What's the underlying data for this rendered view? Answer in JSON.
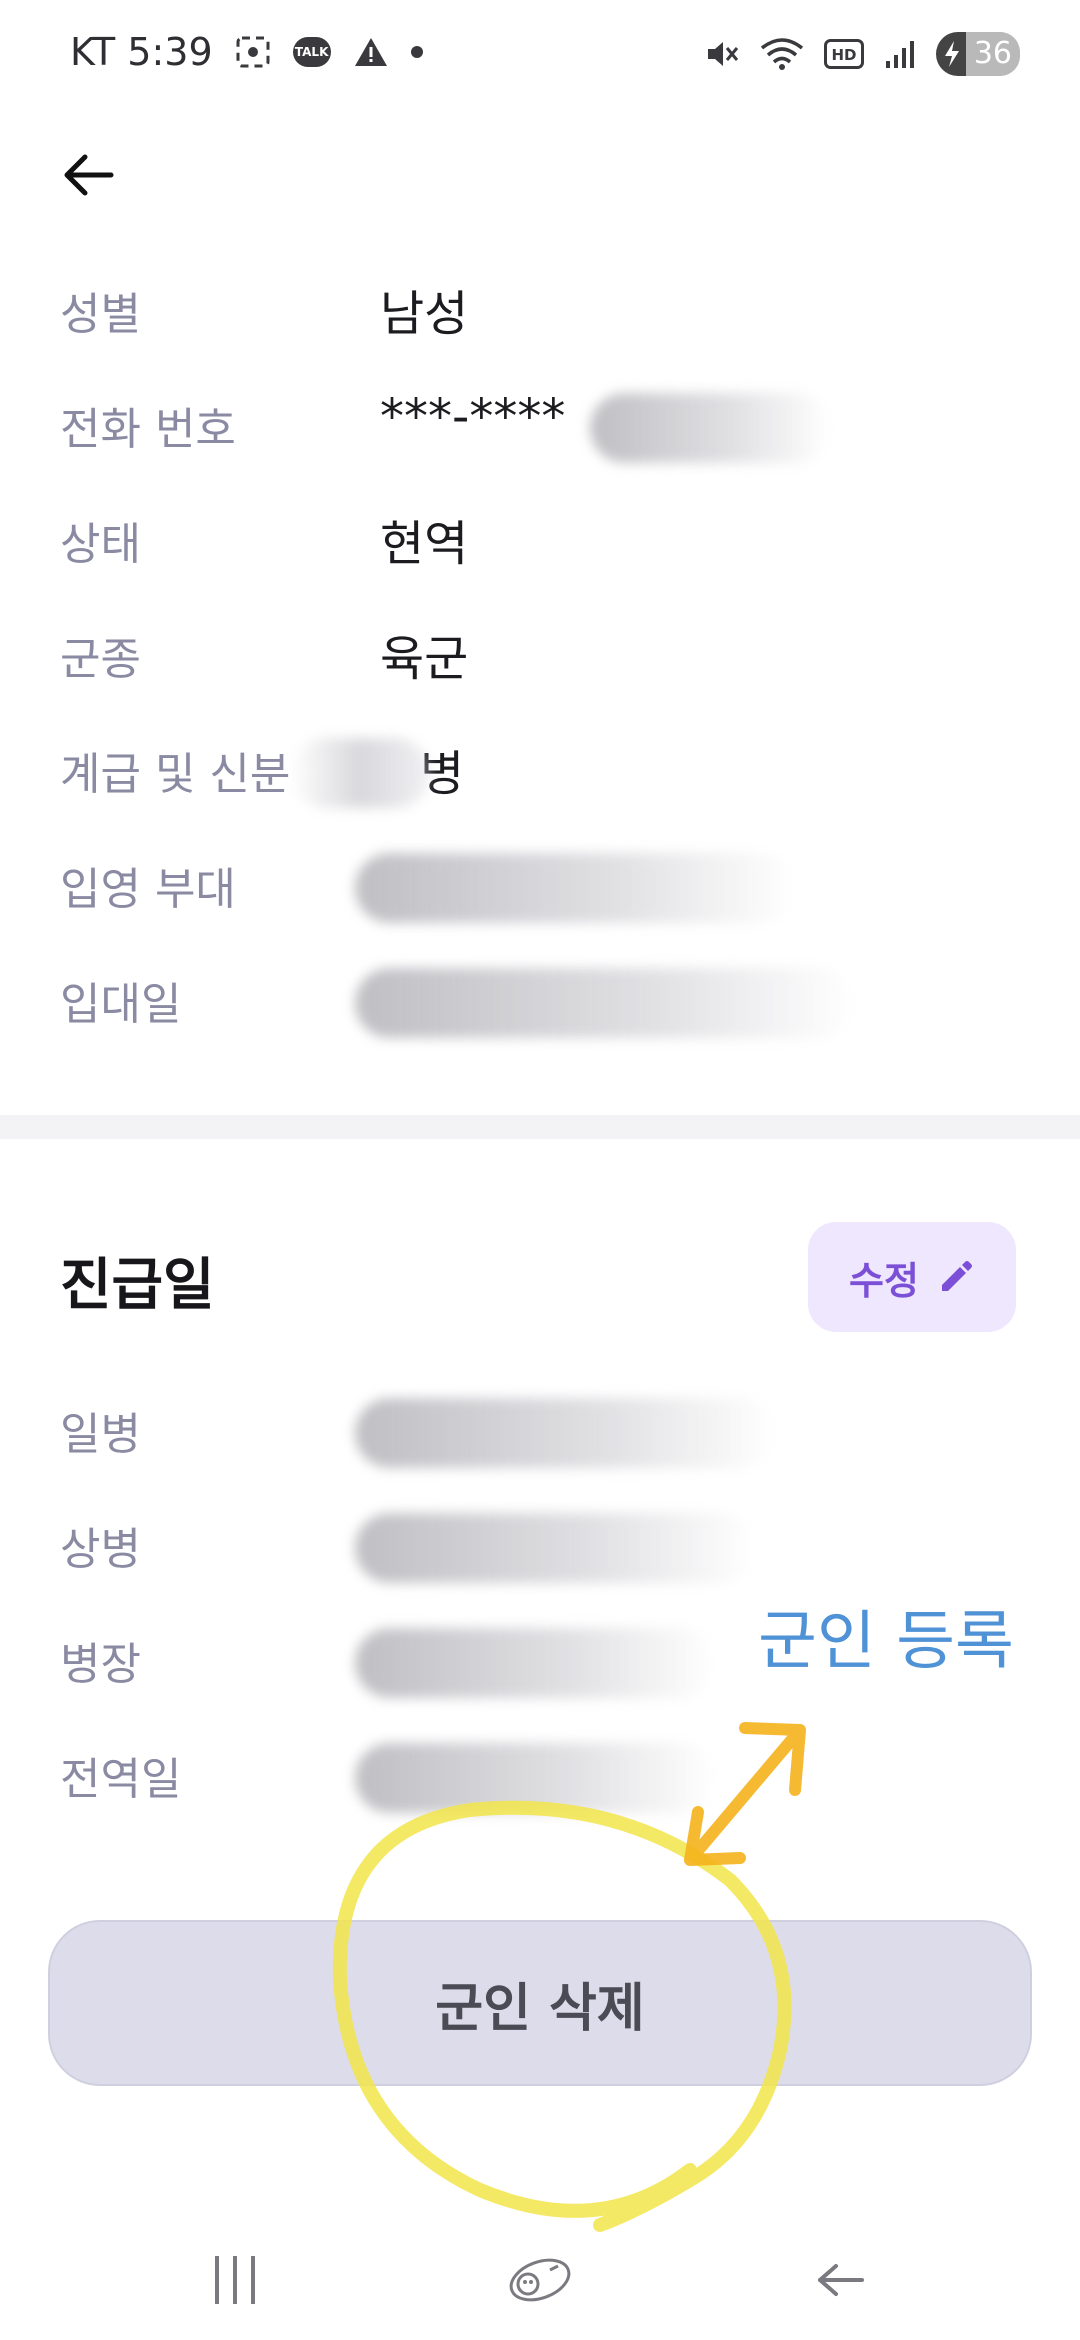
{
  "status_bar": {
    "carrier": "KT",
    "time": "5:39",
    "talk_badge": "TALK",
    "hd_badge": "HD",
    "battery_level": "36",
    "icons": [
      "screenshot-icon",
      "kakaotalk-icon",
      "warning-icon",
      "dot-icon",
      "mute-icon",
      "wifi-icon",
      "hd-icon",
      "signal-icon",
      "battery-charging-icon"
    ]
  },
  "header": {
    "back_icon": "arrow-left-icon"
  },
  "profile": {
    "rows": [
      {
        "label": "성별",
        "value": "남성"
      },
      {
        "label": "전화 번호",
        "value": "***-****"
      },
      {
        "label": "상태",
        "value": "현역"
      },
      {
        "label": "군종",
        "value": "육군"
      },
      {
        "label": "계급 및 신분",
        "value": "병"
      },
      {
        "label": "입영 부대",
        "value": ""
      },
      {
        "label": "입대일",
        "value": ""
      }
    ]
  },
  "promotion": {
    "title": "진급일",
    "edit_label": "수정",
    "edit_icon": "pencil-icon",
    "rows": [
      {
        "label": "일병"
      },
      {
        "label": "상병"
      },
      {
        "label": "병장"
      },
      {
        "label": "전역일"
      }
    ]
  },
  "annotation": {
    "text": "군인 등록"
  },
  "actions": {
    "delete_label": "군인 삭제"
  },
  "nav": {
    "icons": [
      "recent-apps-icon",
      "home-icon",
      "back-icon"
    ]
  },
  "colors": {
    "accent_purple": "#7b4fd6",
    "edit_bg": "#efe7fd",
    "label_gray": "#8a8aa3",
    "delete_bg": "#dddcea",
    "annotation_blue": "#4f92d6",
    "annotation_yellow": "#f2e54a",
    "annotation_orange": "#f4b21c"
  }
}
